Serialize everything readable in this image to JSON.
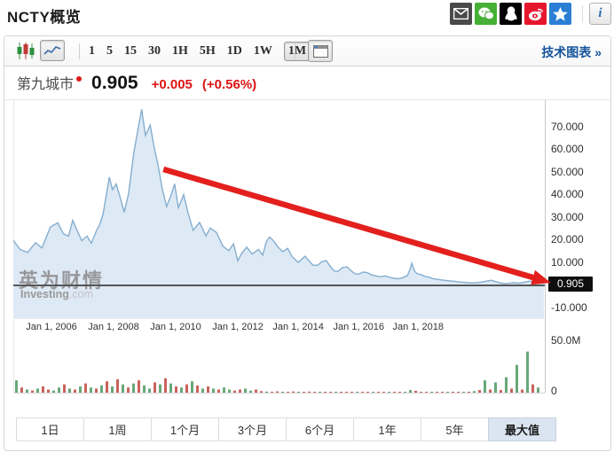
{
  "header": {
    "title": "NCTY概览",
    "share_icons": [
      {
        "name": "email-share-icon",
        "bg": "#4a4a4a"
      },
      {
        "name": "wechat-share-icon",
        "bg": "#45b035"
      },
      {
        "name": "qq-share-icon",
        "bg": "#000000"
      },
      {
        "name": "weibo-share-icon",
        "bg": "#e6162d"
      },
      {
        "name": "qzone-share-icon",
        "bg": "#2a7fd4"
      }
    ],
    "info_label": "i"
  },
  "toolbar": {
    "chart_type_tools": [
      "candlestick-chart-icon",
      "line-chart-icon"
    ],
    "selected_chart_type": "line",
    "intervals": [
      "1",
      "5",
      "15",
      "30",
      "1H",
      "5H",
      "1D",
      "1W",
      "1M"
    ],
    "selected_interval": "1M",
    "layout_tool": "panel-layout-icon",
    "tech_link": "技术图表 »"
  },
  "quote": {
    "name": "第九城市",
    "price": "0.905",
    "change": "+0.005",
    "change_pct": "(+0.56%)"
  },
  "watermark": {
    "cn": "英为财情",
    "en": "Investing",
    "dotcom": ".com"
  },
  "ranges": [
    {
      "label": "1日",
      "selected": false
    },
    {
      "label": "1周",
      "selected": false
    },
    {
      "label": "1个月",
      "selected": false
    },
    {
      "label": "3个月",
      "selected": false
    },
    {
      "label": "6个月",
      "selected": false
    },
    {
      "label": "1年",
      "selected": false
    },
    {
      "label": "5年",
      "selected": false
    },
    {
      "label": "最大值",
      "selected": true
    }
  ],
  "colors": {
    "area_fill": "#dde9f5",
    "area_line": "#85aecf",
    "vol_green": "#68a879",
    "vol_red": "#c9635c",
    "arrow": "#e3201d",
    "accent_blue": "#15549c",
    "price_line": "#565656",
    "badge_bg": "#0f0f0f",
    "badge_text": "#ffffff",
    "up_text": "#dd1414"
  },
  "chart_data": {
    "type": "area",
    "title": "NCTY 第九城市 monthly price with volume",
    "x_axis": {
      "labels": [
        "Jan 1, 2006",
        "Jan 1, 2008",
        "Jan 1, 2010",
        "Jan 1, 2012",
        "Jan 1, 2014",
        "Jan 1, 2016",
        "Jan 1, 2018"
      ],
      "t": [
        0.072,
        0.189,
        0.306,
        0.423,
        0.537,
        0.651,
        0.763
      ]
    },
    "y_axis": {
      "labels": [
        "70.000",
        "60.000",
        "50.000",
        "40.000",
        "30.000",
        "20.000",
        "10.000",
        "-10.000"
      ],
      "values": [
        70,
        60,
        50,
        40,
        30,
        20,
        10,
        -10
      ],
      "ylim": [
        -15,
        81
      ]
    },
    "current_price": {
      "label": "0.905",
      "value": 0.905
    },
    "volume_axis": {
      "labels": [
        "50.0M",
        "0"
      ],
      "values": [
        50,
        0
      ]
    },
    "price_points": [
      [
        0.0,
        19.5
      ],
      [
        0.013,
        15.5
      ],
      [
        0.027,
        14.2
      ],
      [
        0.042,
        18.5
      ],
      [
        0.054,
        16.2
      ],
      [
        0.07,
        25.5
      ],
      [
        0.084,
        27.3
      ],
      [
        0.094,
        22.5
      ],
      [
        0.104,
        21.4
      ],
      [
        0.112,
        28.4
      ],
      [
        0.12,
        24.0
      ],
      [
        0.129,
        19.4
      ],
      [
        0.139,
        21.4
      ],
      [
        0.147,
        18.2
      ],
      [
        0.157,
        24.0
      ],
      [
        0.162,
        26.0
      ],
      [
        0.169,
        31.0
      ],
      [
        0.181,
        47.5
      ],
      [
        0.187,
        42.0
      ],
      [
        0.194,
        44.5
      ],
      [
        0.202,
        38.0
      ],
      [
        0.209,
        32.0
      ],
      [
        0.217,
        40.0
      ],
      [
        0.227,
        58.0
      ],
      [
        0.236,
        70.0
      ],
      [
        0.242,
        77.5
      ],
      [
        0.249,
        66.0
      ],
      [
        0.258,
        70.5
      ],
      [
        0.266,
        60.0
      ],
      [
        0.273,
        52.5
      ],
      [
        0.281,
        42.0
      ],
      [
        0.289,
        34.5
      ],
      [
        0.298,
        40.0
      ],
      [
        0.304,
        44.5
      ],
      [
        0.311,
        34.0
      ],
      [
        0.321,
        39.8
      ],
      [
        0.329,
        32.0
      ],
      [
        0.339,
        24.0
      ],
      [
        0.351,
        27.5
      ],
      [
        0.363,
        21.5
      ],
      [
        0.371,
        25.0
      ],
      [
        0.383,
        23.0
      ],
      [
        0.395,
        17.0
      ],
      [
        0.406,
        15.0
      ],
      [
        0.415,
        18.0
      ],
      [
        0.423,
        10.5
      ],
      [
        0.431,
        14.0
      ],
      [
        0.44,
        16.5
      ],
      [
        0.45,
        13.5
      ],
      [
        0.462,
        15.5
      ],
      [
        0.47,
        13.0
      ],
      [
        0.477,
        19.0
      ],
      [
        0.483,
        21.0
      ],
      [
        0.49,
        19.5
      ],
      [
        0.498,
        16.8
      ],
      [
        0.508,
        14.5
      ],
      [
        0.517,
        16.0
      ],
      [
        0.525,
        12.5
      ],
      [
        0.537,
        9.8
      ],
      [
        0.545,
        11.5
      ],
      [
        0.55,
        12.5
      ],
      [
        0.559,
        10.0
      ],
      [
        0.565,
        8.5
      ],
      [
        0.574,
        8.6
      ],
      [
        0.582,
        10.2
      ],
      [
        0.59,
        10.5
      ],
      [
        0.599,
        7.5
      ],
      [
        0.605,
        6.0
      ],
      [
        0.612,
        5.8
      ],
      [
        0.62,
        7.5
      ],
      [
        0.629,
        7.8
      ],
      [
        0.637,
        6.0
      ],
      [
        0.644,
        4.8
      ],
      [
        0.651,
        4.6
      ],
      [
        0.659,
        5.5
      ],
      [
        0.667,
        5.3
      ],
      [
        0.676,
        4.2
      ],
      [
        0.684,
        3.8
      ],
      [
        0.691,
        3.4
      ],
      [
        0.701,
        3.8
      ],
      [
        0.709,
        3.2
      ],
      [
        0.717,
        2.8
      ],
      [
        0.726,
        2.5
      ],
      [
        0.734,
        3.0
      ],
      [
        0.743,
        4.0
      ],
      [
        0.748,
        7.0
      ],
      [
        0.751,
        9.4
      ],
      [
        0.756,
        6.0
      ],
      [
        0.761,
        4.8
      ],
      [
        0.768,
        4.4
      ],
      [
        0.776,
        3.6
      ],
      [
        0.784,
        3.2
      ],
      [
        0.791,
        2.6
      ],
      [
        0.799,
        2.3
      ],
      [
        0.808,
        2.0
      ],
      [
        0.818,
        1.7
      ],
      [
        0.828,
        1.5
      ],
      [
        0.838,
        1.2
      ],
      [
        0.848,
        1.0
      ],
      [
        0.858,
        0.8
      ],
      [
        0.868,
        0.7
      ],
      [
        0.88,
        1.0
      ],
      [
        0.89,
        1.4
      ],
      [
        0.901,
        1.9
      ],
      [
        0.91,
        1.2
      ],
      [
        0.918,
        0.7
      ],
      [
        0.925,
        0.4
      ],
      [
        0.933,
        0.5
      ],
      [
        0.943,
        0.8
      ],
      [
        0.953,
        0.6
      ],
      [
        0.963,
        1.0
      ],
      [
        0.973,
        1.5
      ],
      [
        0.982,
        1.2
      ],
      [
        0.99,
        0.8
      ],
      [
        1.0,
        0.905
      ]
    ],
    "volume_bars": [
      [
        12,
        "g"
      ],
      [
        5,
        "r"
      ],
      [
        3,
        "g"
      ],
      [
        2,
        "r"
      ],
      [
        4,
        "g"
      ],
      [
        6,
        "r"
      ],
      [
        3,
        "r"
      ],
      [
        2,
        "g"
      ],
      [
        5,
        "g"
      ],
      [
        8,
        "r"
      ],
      [
        4,
        "g"
      ],
      [
        3,
        "r"
      ],
      [
        6,
        "g"
      ],
      [
        9,
        "r"
      ],
      [
        5,
        "g"
      ],
      [
        4,
        "r"
      ],
      [
        7,
        "g"
      ],
      [
        11,
        "r"
      ],
      [
        6,
        "g"
      ],
      [
        13,
        "r"
      ],
      [
        8,
        "g"
      ],
      [
        5,
        "r"
      ],
      [
        9,
        "g"
      ],
      [
        12,
        "r"
      ],
      [
        7,
        "g"
      ],
      [
        4,
        "g"
      ],
      [
        10,
        "r"
      ],
      [
        8,
        "g"
      ],
      [
        14,
        "r"
      ],
      [
        9,
        "g"
      ],
      [
        6,
        "r"
      ],
      [
        5,
        "g"
      ],
      [
        8,
        "r"
      ],
      [
        11,
        "g"
      ],
      [
        7,
        "r"
      ],
      [
        4,
        "g"
      ],
      [
        6,
        "r"
      ],
      [
        4,
        "g"
      ],
      [
        3,
        "r"
      ],
      [
        5,
        "g"
      ],
      [
        3,
        "g"
      ],
      [
        2,
        "r"
      ],
      [
        3,
        "r"
      ],
      [
        4,
        "g"
      ],
      [
        2,
        "g"
      ],
      [
        3,
        "r"
      ],
      [
        1.5,
        "r"
      ],
      [
        1,
        "g"
      ],
      [
        0.8,
        "r"
      ],
      [
        1.2,
        "r"
      ],
      [
        0.7,
        "g"
      ],
      [
        0.9,
        "r"
      ],
      [
        1.1,
        "r"
      ],
      [
        0.6,
        "g"
      ],
      [
        0.8,
        "r"
      ],
      [
        1,
        "r"
      ],
      [
        0.5,
        "r"
      ],
      [
        0.9,
        "g"
      ],
      [
        0.7,
        "r"
      ],
      [
        0.6,
        "r"
      ],
      [
        0.8,
        "g"
      ],
      [
        0.5,
        "r"
      ],
      [
        0.7,
        "r"
      ],
      [
        0.9,
        "r"
      ],
      [
        0.5,
        "g"
      ],
      [
        0.6,
        "r"
      ],
      [
        0.4,
        "r"
      ],
      [
        0.7,
        "g"
      ],
      [
        0.5,
        "r"
      ],
      [
        0.4,
        "r"
      ],
      [
        0.6,
        "g"
      ],
      [
        0.4,
        "r"
      ],
      [
        0.5,
        "r"
      ],
      [
        0.8,
        "g"
      ],
      [
        2.5,
        "g"
      ],
      [
        1.8,
        "r"
      ],
      [
        0.9,
        "r"
      ],
      [
        0.6,
        "r"
      ],
      [
        0.5,
        "g"
      ],
      [
        0.4,
        "r"
      ],
      [
        0.6,
        "r"
      ],
      [
        0.4,
        "g"
      ],
      [
        0.5,
        "r"
      ],
      [
        0.3,
        "r"
      ],
      [
        0.5,
        "g"
      ],
      [
        0.4,
        "r"
      ],
      [
        1.5,
        "g"
      ],
      [
        2.5,
        "r"
      ],
      [
        12,
        "g"
      ],
      [
        3,
        "r"
      ],
      [
        10,
        "g"
      ],
      [
        2.5,
        "r"
      ],
      [
        15,
        "g"
      ],
      [
        4,
        "r"
      ],
      [
        27,
        "g"
      ],
      [
        3,
        "r"
      ],
      [
        40,
        "g"
      ],
      [
        8,
        "r"
      ],
      [
        5,
        "g"
      ]
    ],
    "annotation_arrow": {
      "from_t": 0.283,
      "from_v": 51.0,
      "to_t": 1.013,
      "to_v": 0.8
    }
  }
}
